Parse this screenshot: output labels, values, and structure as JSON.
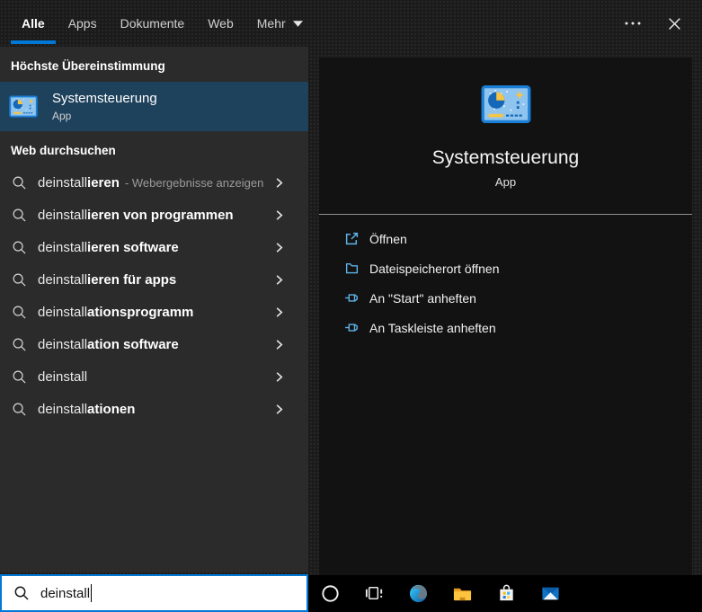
{
  "tabs": {
    "items": [
      {
        "label": "Alle",
        "active": true
      },
      {
        "label": "Apps",
        "active": false
      },
      {
        "label": "Dokumente",
        "active": false
      },
      {
        "label": "Web",
        "active": false
      },
      {
        "label": "Mehr",
        "active": false,
        "has_dropdown": true
      }
    ]
  },
  "left": {
    "best_match_header": "Höchste Übereinstimmung",
    "best_match": {
      "title": "Systemsteuerung",
      "subtitle": "App",
      "icon": "control-panel-icon"
    },
    "web_search_header": "Web durchsuchen",
    "suggestions": [
      {
        "typed": "deinstall",
        "completion": "ieren",
        "note": "- Webergebnisse anzeigen"
      },
      {
        "typed": "deinstall",
        "completion": "ieren von programmen",
        "note": ""
      },
      {
        "typed": "deinstall",
        "completion": "ieren software",
        "note": ""
      },
      {
        "typed": "deinstall",
        "completion": "ieren für apps",
        "note": ""
      },
      {
        "typed": "deinstall",
        "completion": "ationsprogramm",
        "note": ""
      },
      {
        "typed": "deinstall",
        "completion": "ation software",
        "note": ""
      },
      {
        "typed": "deinstall",
        "completion": "",
        "note": ""
      },
      {
        "typed": "deinstall",
        "completion": "ationen",
        "note": ""
      }
    ]
  },
  "right": {
    "app_title": "Systemsteuerung",
    "app_subtitle": "App",
    "app_icon": "control-panel-icon",
    "actions": [
      {
        "icon": "open-icon",
        "label": "Öffnen"
      },
      {
        "icon": "file-location-icon",
        "label": "Dateispeicherort öffnen"
      },
      {
        "icon": "pin-icon",
        "label": "An \"Start\" anheften"
      },
      {
        "icon": "pin-icon",
        "label": "An Taskleiste anheften"
      }
    ]
  },
  "search": {
    "value": "deinstall",
    "icon": "search-icon"
  },
  "taskbar": {
    "buttons": [
      {
        "icon": "cortana-icon",
        "name": "cortana"
      },
      {
        "icon": "task-view-icon",
        "name": "task-view"
      },
      {
        "icon": "edge-icon",
        "name": "edge"
      },
      {
        "icon": "file-explorer-icon",
        "name": "file-explorer"
      },
      {
        "icon": "store-icon",
        "name": "store"
      },
      {
        "icon": "mail-icon",
        "name": "mail"
      }
    ]
  },
  "colors": {
    "accent": "#0078d7",
    "selected_row": "#1f425c",
    "action_icon": "#5fb2e8"
  }
}
